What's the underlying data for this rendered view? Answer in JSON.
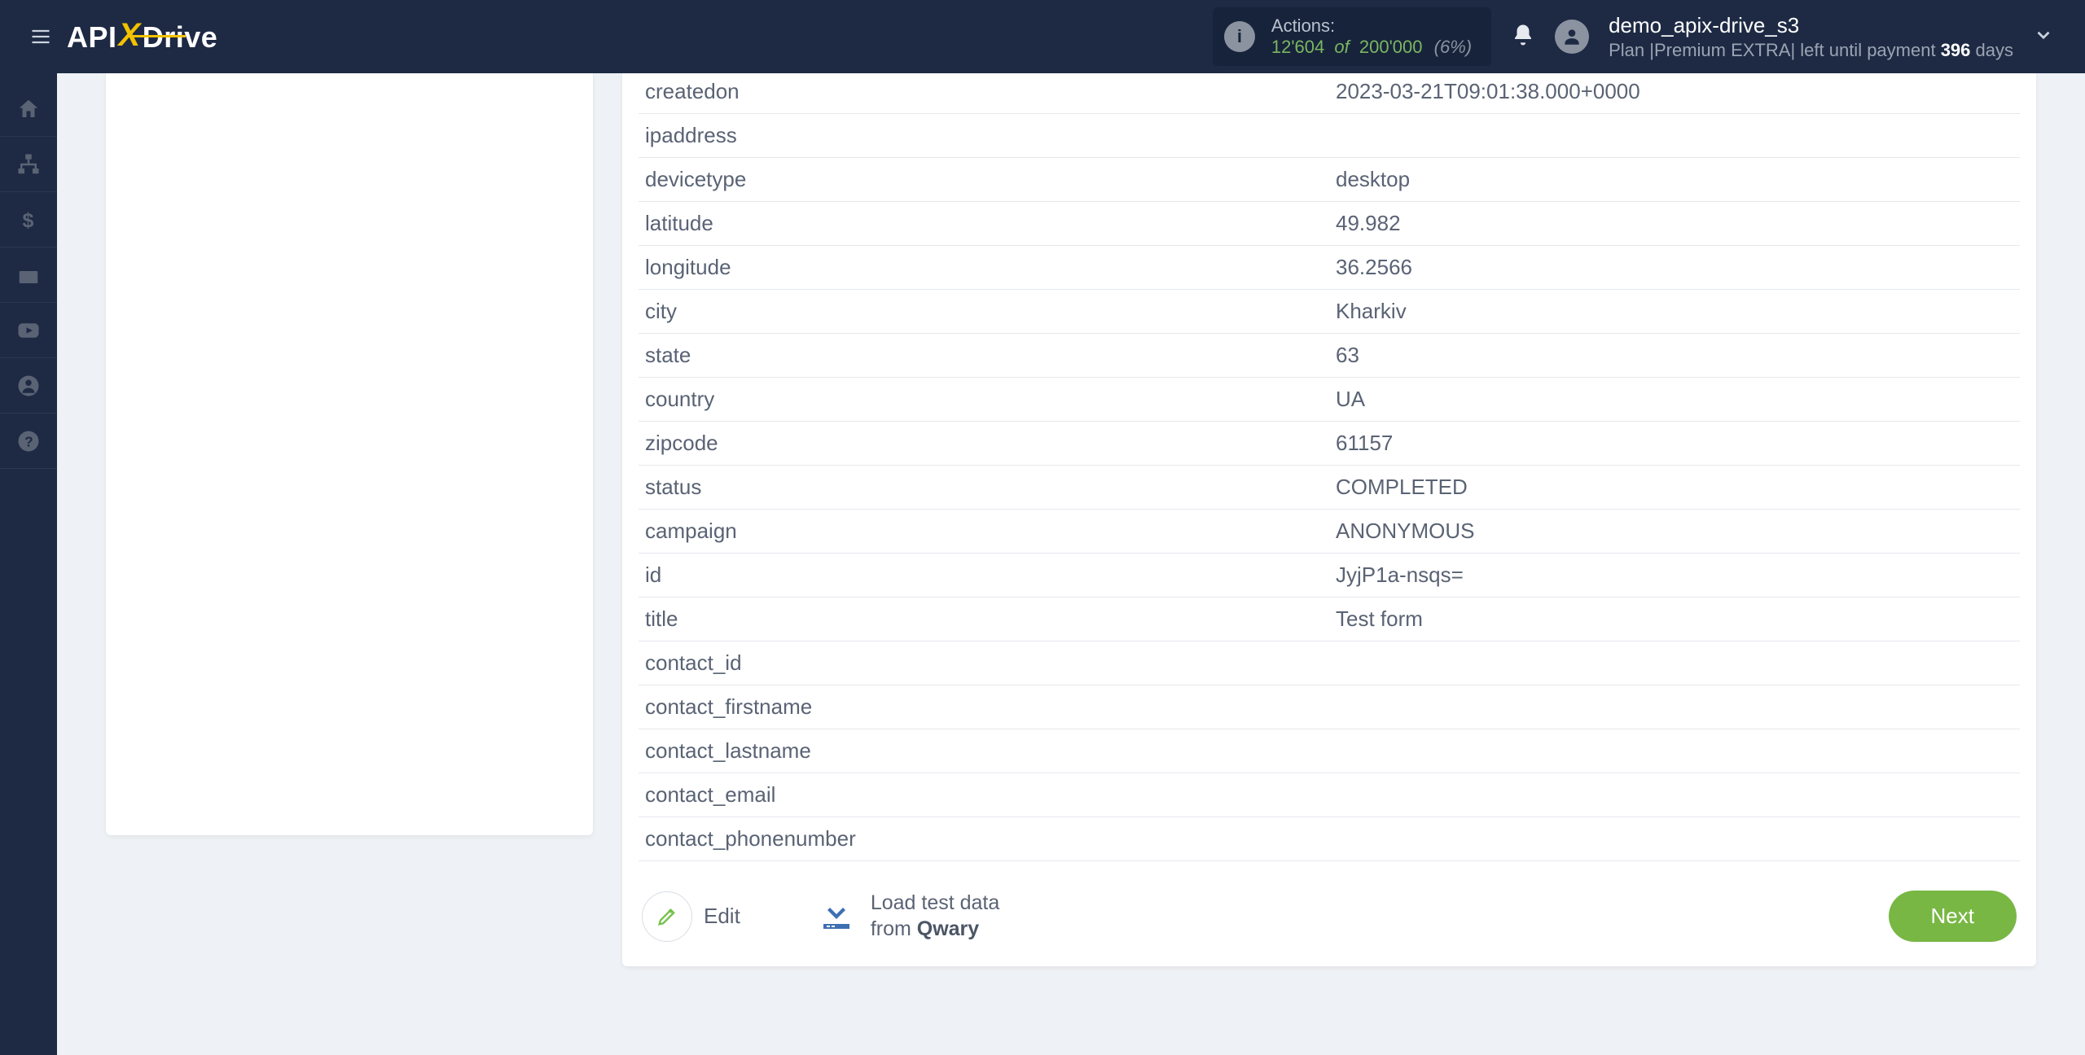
{
  "header": {
    "actions_label": "Actions:",
    "actions_used": "12'604",
    "actions_of": "of",
    "actions_total": "200'000",
    "actions_pct": "(6%)",
    "user_name": "demo_apix-drive_s3",
    "plan_prefix": "Plan |",
    "plan_name": "Premium EXTRA",
    "plan_suffix": "| left until payment ",
    "plan_days": "396",
    "plan_days_unit": " days"
  },
  "logo": {
    "api": "API",
    "x": "X",
    "drive": "Drive"
  },
  "rows": [
    {
      "k": "createdon",
      "v": "2023-03-21T09:01:38.000+0000"
    },
    {
      "k": "ipaddress",
      "v": ""
    },
    {
      "k": "devicetype",
      "v": "desktop"
    },
    {
      "k": "latitude",
      "v": "49.982"
    },
    {
      "k": "longitude",
      "v": "36.2566"
    },
    {
      "k": "city",
      "v": "Kharkiv"
    },
    {
      "k": "state",
      "v": "63"
    },
    {
      "k": "country",
      "v": "UA"
    },
    {
      "k": "zipcode",
      "v": "61157"
    },
    {
      "k": "status",
      "v": "COMPLETED"
    },
    {
      "k": "campaign",
      "v": "ANONYMOUS"
    },
    {
      "k": "id",
      "v": "JyjP1a-nsqs="
    },
    {
      "k": "title",
      "v": "Test form"
    },
    {
      "k": "contact_id",
      "v": ""
    },
    {
      "k": "contact_firstname",
      "v": ""
    },
    {
      "k": "contact_lastname",
      "v": ""
    },
    {
      "k": "contact_email",
      "v": ""
    },
    {
      "k": "contact_phonenumber",
      "v": ""
    }
  ],
  "footer": {
    "edit": "Edit",
    "load_line1": "Load test data",
    "load_line2_pre": "from ",
    "load_line2_bold": "Qwary",
    "next": "Next"
  }
}
